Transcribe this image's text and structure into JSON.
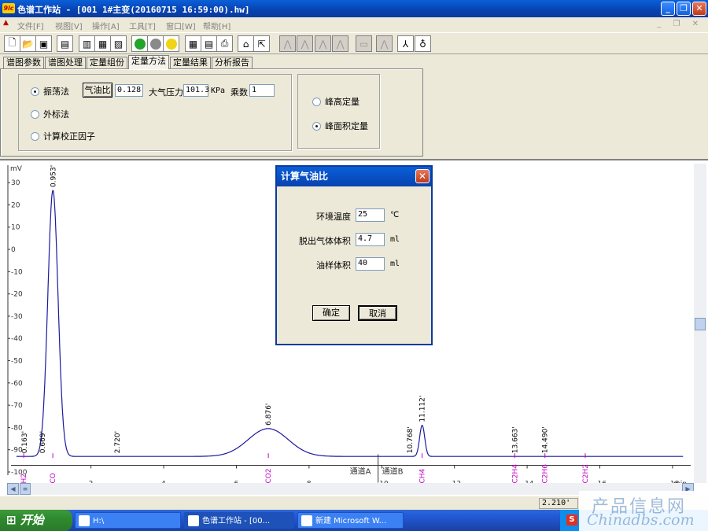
{
  "window": {
    "logo_text": "9lc",
    "title": "色谱工作站 - [001 1#主变(20160715 16:59:00).hw]",
    "minimize_glyph": "_",
    "maximize_glyph": "❐",
    "close_glyph": "✕"
  },
  "menu": {
    "items": [
      "文件[F]",
      "视图[V]",
      "操作[A]",
      "工具[T]",
      "窗口[W]",
      "帮助[H]"
    ],
    "mdi_controls": "_ ❐ ✕"
  },
  "toolbar": {
    "buttons": [
      "new-file-icon",
      "open-folder-icon",
      "save-icon",
      "print-preview-icon",
      "bar-chart-icon",
      "grid-icon",
      "histogram-icon",
      "green-run-icon",
      "gray-stop-icon",
      "yellow-face-icon",
      "calculator-icon",
      "report-icon",
      "printer-icon",
      "baseline-icon",
      "export-icon",
      "peak-icon-1",
      "peak-icon-2",
      "peak-icon-3",
      "peak-icon-4",
      "peak-icon-5",
      "split-peak-icon",
      "person-icon"
    ],
    "colors": {
      "green": "#22a52a",
      "gray": "#8a8a8a",
      "yellow": "#f1d416"
    }
  },
  "tabs": [
    "谱图参数",
    "谱图处理",
    "定量组份",
    "定量方法",
    "定量结果",
    "分析报告"
  ],
  "active_tab": "定量方法",
  "method_panel": {
    "options": [
      {
        "label": "振荡法",
        "selected": true
      },
      {
        "label": "外标法",
        "selected": false
      },
      {
        "label": "计算校正因子",
        "selected": false
      }
    ],
    "gas_oil_ratio_button": "气油比",
    "gas_oil_ratio_value": "0.128",
    "pressure_label": "大气压力",
    "pressure_value": "101.3",
    "pressure_unit": "KPa",
    "multiplier_label": "乘数",
    "multiplier_value": "1",
    "quant_options": [
      {
        "label": "峰高定量",
        "selected": false
      },
      {
        "label": "峰面积定量",
        "selected": true
      }
    ]
  },
  "dialog": {
    "title": "计算气油比",
    "close_glyph": "✕",
    "fields": [
      {
        "label": "环境温度",
        "value": "25",
        "unit": "℃"
      },
      {
        "label": "脱出气体体积",
        "value": "4.7",
        "unit": "ml"
      },
      {
        "label": "油样体积",
        "value": "40",
        "unit": "ml"
      }
    ],
    "ok_label": "确定",
    "cancel_label": "取消"
  },
  "chart_data": {
    "type": "line",
    "ylabel": "mV",
    "xlabel": "min",
    "ylim": [
      -100,
      35
    ],
    "xlim": [
      -0.2,
      18.5
    ],
    "y_ticks": [
      30,
      20,
      10,
      0,
      -10,
      -20,
      -30,
      -40,
      -50,
      -60,
      -70,
      -80,
      -90,
      -100
    ],
    "y_tick_labels": [
      "30",
      "20",
      "10",
      "0",
      "-10",
      "-20",
      "-30",
      "-40",
      "-50",
      "-60",
      "-70",
      "-80",
      "-90",
      "-100"
    ],
    "x_ticks": [
      2,
      4,
      6,
      8,
      10,
      12,
      14,
      16,
      18
    ],
    "x_tick_labels": [
      "2",
      "4",
      "6",
      "8",
      "10",
      "12",
      "14",
      "16",
      "18"
    ],
    "baseline": -93,
    "line_color": "#1a1aa0",
    "annotation_color": "#c000c0",
    "peaks": [
      {
        "rt": 0.953,
        "height": 26.5,
        "width": 0.14,
        "label": "0.953'"
      },
      {
        "rt": 6.876,
        "height": -80.5,
        "width": 0.55,
        "label": "6.876'"
      },
      {
        "rt": 11.112,
        "height": -79,
        "width": 0.07,
        "label": "11.112'"
      }
    ],
    "rt_labels": [
      {
        "rt": 0.163,
        "label": "0.163'"
      },
      {
        "rt": 0.669,
        "label": "0.669'"
      },
      {
        "rt": 2.72,
        "label": "2.720'"
      },
      {
        "rt": 10.768,
        "label": "10.768'"
      },
      {
        "rt": 13.663,
        "label": "13.663'"
      },
      {
        "rt": 14.49,
        "label": "14.490'"
      }
    ],
    "components": [
      {
        "name": "H2",
        "rt": 0.15
      },
      {
        "name": "CO",
        "rt": 0.95
      },
      {
        "name": "CO2",
        "rt": 6.88
      },
      {
        "name": "CH4",
        "rt": 11.11
      },
      {
        "name": "C2H4",
        "rt": 13.66
      },
      {
        "name": "C2H6",
        "rt": 14.49
      },
      {
        "name": "C2H2",
        "rt": 15.6
      }
    ],
    "channel_labels": [
      "通道A",
      "通道B"
    ],
    "channel_split_rt": 9.9
  },
  "statusbar": {
    "cursor_value": "2.210'"
  },
  "taskbar": {
    "start_label": "开始",
    "tasks": [
      "H:\\",
      "色谱工作站 - [00...",
      "新建 Microsoft W..."
    ],
    "ime_label": "S"
  },
  "watermark": {
    "line1": "产品信息网",
    "line2": "Chinadbs.com"
  }
}
